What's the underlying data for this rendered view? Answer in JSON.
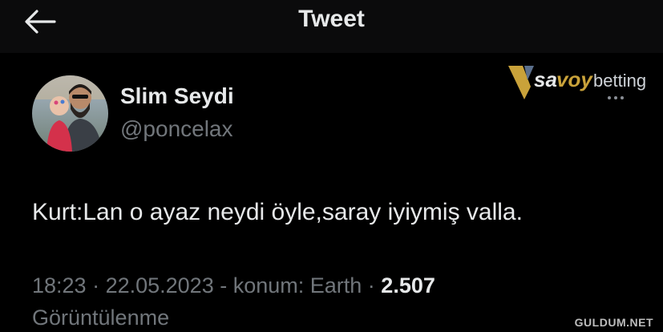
{
  "header": {
    "title": "Tweet",
    "back_icon": "arrow-left-icon"
  },
  "author": {
    "display_name": "Slim Seydi",
    "handle": "@poncelax",
    "avatar_icon": "user-avatar"
  },
  "watermark": {
    "brand_prefix": "sa",
    "brand_mid": "voy",
    "brand_suffix": "betting"
  },
  "tweet": {
    "text": "Kurt:Lan o ayaz neydi öyle,saray iyiymiş valla."
  },
  "meta": {
    "time": "18:23",
    "sep1": " · ",
    "date": "22.05.2023",
    "location": " - konum: Earth",
    "sep2": " · ",
    "views_count": "2.507",
    "views_label": "Görüntülenme"
  },
  "site_watermark": "GULDUM.NET",
  "colors": {
    "background": "#000000",
    "header_bg": "#0b0b0c",
    "primary_text": "#e7e9ea",
    "secondary_text": "#71767b",
    "brand_gold": "#c9a23a"
  }
}
